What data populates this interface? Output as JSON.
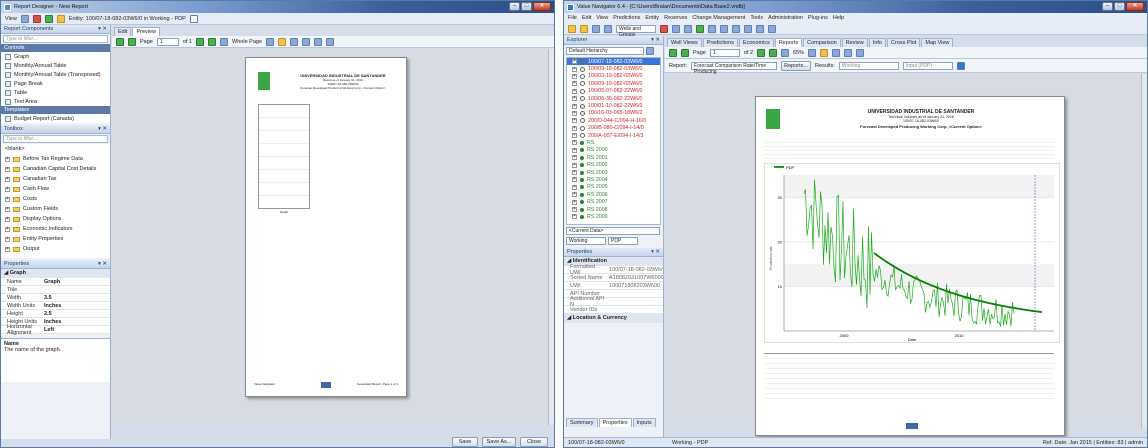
{
  "left": {
    "title": "Report Designer - New Report",
    "view_label": "View",
    "entity_label": "Entity: 100/07-18-082-03W6/0 in Working - PDP",
    "components_header": "Report Components",
    "filter_placeholder": "Type to filter...",
    "controls_section": "Controls",
    "controls": [
      "Graph",
      "Monthly/Annual Table",
      "Monthly/Annual Table (Transposed)",
      "Page Break",
      "Table",
      "Text Area"
    ],
    "templates_section": "Templates",
    "templates": [
      "Budget Report (Canada)"
    ],
    "tabs": [
      "Edit",
      "Preview"
    ],
    "page_label": "Page",
    "page_value": "1",
    "page_of": "of 1",
    "zoom_label": "Whole Page",
    "toolbox_header": "Toolbox",
    "toolbox_filter": "Type to filter...",
    "toolbox_items": [
      "<blank>",
      "Before Tax Regime Data",
      "Canadian Capital Cost Details",
      "Canadian Tax",
      "Cash Flow",
      "Costs",
      "Custom Fields",
      "Display Options",
      "Economic Indicators",
      "Entity Properties",
      "Output"
    ],
    "properties_header": "Properties",
    "prop_group": "Graph",
    "props": [
      {
        "k": "Name",
        "v": "Graph"
      },
      {
        "k": "Title",
        "v": ""
      },
      {
        "k": "Width",
        "v": "3.5"
      },
      {
        "k": "Width Units",
        "v": "Inches"
      },
      {
        "k": "Height",
        "v": "2.5"
      },
      {
        "k": "Height Units",
        "v": "Inches"
      },
      {
        "k": "Horizontal Alignment",
        "v": "Left"
      }
    ],
    "desc_title": "Name",
    "desc_text": "The name of the graph.",
    "preview_univ": "UNIVERSIDAD INDUSTRIAL DE SANTANDER",
    "preview_sub1": "Result as of January 01, 2016",
    "preview_sub2": "100/07-18-082-03W6/0",
    "preview_sub3": "Forecast Developed Producing Working Corp, <Current Option>",
    "preview_table_label": "Graph",
    "footer_left": "Value Navigator",
    "footer_right": "Generated Report, Page 1 of 1",
    "save": "Save",
    "save_as": "Save As...",
    "close": "Close"
  },
  "right": {
    "title": "Value Navigator 6.4 - [C:\\Users\\Braian\\Documents\\Data Base2.vndb]",
    "menus": [
      "File",
      "Edit",
      "View",
      "Predictions",
      "Entity",
      "Reserves",
      "Change Management",
      "Tools",
      "Administration",
      "Plug-ins",
      "Help"
    ],
    "wells_groups": "Wells and Groups",
    "explorer_header": "Explorer",
    "hierarchy": "Default Hierarchy",
    "wells": [
      {
        "name": "100/07-18-082-03W6/0",
        "color": "sel"
      },
      {
        "name": "100/09-18-082-03W6/0",
        "color": "red"
      },
      {
        "name": "100/03-19-082-03W6/0",
        "color": "red"
      },
      {
        "name": "100/09-19-082-03W6/0",
        "color": "red"
      },
      {
        "name": "100/05-07-082-22W6/0",
        "color": "red"
      },
      {
        "name": "100/06-30-082-22W6/0",
        "color": "red"
      },
      {
        "name": "100/01-10-082-22W6/0",
        "color": "red"
      },
      {
        "name": "100/16-03-065-18W6/2",
        "color": "red"
      },
      {
        "name": "200/D-044-C/094-H-16/0",
        "color": "red"
      },
      {
        "name": "200/B-080-C/094-I-14/0",
        "color": "red"
      },
      {
        "name": "200/A-007-E/094-I-14/3",
        "color": "red"
      },
      {
        "name": "RS",
        "color": "green"
      },
      {
        "name": "RS 2000",
        "color": "green"
      },
      {
        "name": "RS 2001",
        "color": "green"
      },
      {
        "name": "RS 2002",
        "color": "green"
      },
      {
        "name": "RS 2003",
        "color": "green"
      },
      {
        "name": "RS 2004",
        "color": "green"
      },
      {
        "name": "RS 2005",
        "color": "green"
      },
      {
        "name": "RS 2006",
        "color": "green"
      },
      {
        "name": "RS 2007",
        "color": "green"
      },
      {
        "name": "RS 2008",
        "color": "green"
      },
      {
        "name": "RS 2009",
        "color": "green"
      }
    ],
    "current_data": "<Current Data>",
    "working": "Working",
    "pdp": "PDP",
    "properties_header": "Properties",
    "identification": "Identification",
    "ident_props": [
      {
        "k": "Formatted UWI",
        "v": "100/07-18-082-03W6/0"
      },
      {
        "k": "Sorted Name",
        "v": "A18082031007W6000"
      },
      {
        "k": "UWI",
        "v": "100071808203W600"
      },
      {
        "k": "API Number",
        "v": ""
      },
      {
        "k": "Additional API N",
        "v": ""
      },
      {
        "k": "Vendor IDs",
        "v": ""
      }
    ],
    "location": "Location & Currency",
    "bottom_tabs": [
      "Summary",
      "Properties",
      "Inputs"
    ],
    "tabs": [
      "Well Views",
      "Predictions",
      "Economics",
      "Reports",
      "Comparison",
      "Review",
      "Info",
      "Cross Plot",
      "Map View"
    ],
    "page_label": "Page",
    "page_value": "1",
    "page_of": "of 2",
    "zoom": "65%",
    "report_label": "Report:",
    "report_value": "Forecast Comparison Rate/Time Producing",
    "reports_btn": "Reports...",
    "results_label": "Results:",
    "results_value": "Working",
    "input_value": "Input (PDP)",
    "rep_title": "UNIVERSIDAD INDUSTRIAL DE SANTANDER",
    "rep_sub1": "Technical Volumes as of January 01, 2016",
    "rep_sub2": "100/07-18-082-03W6/0",
    "rep_sub3": "Forecast Developed Producing Working Corp, <Current Option>",
    "legend_label": "PDP",
    "forecast_label": "Forecast",
    "status_left": "100/07-18-082-03W6/0",
    "status_mid": "Working - PDP",
    "status_right": "Ref. Date: Jan 2015 | Entities: 83 | admin"
  },
  "chart_data": {
    "type": "line",
    "title": "",
    "series": [
      {
        "name": "PDP",
        "values": []
      }
    ],
    "xlabel": "Date",
    "ylabel": "Production rate",
    "y_ticks": [
      "10",
      "20",
      "30"
    ],
    "x_ticks": [
      "2000",
      "2010"
    ]
  }
}
